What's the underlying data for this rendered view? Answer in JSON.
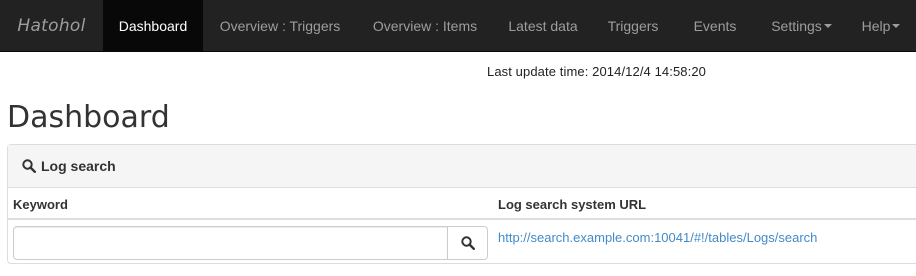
{
  "navbar": {
    "brand": "Hatohol",
    "items": [
      {
        "label": "Dashboard"
      },
      {
        "label": "Overview : Triggers"
      },
      {
        "label": "Overview : Items"
      },
      {
        "label": "Latest data"
      },
      {
        "label": "Triggers"
      },
      {
        "label": "Events"
      },
      {
        "label": "Settings"
      },
      {
        "label": "Help"
      }
    ]
  },
  "status": {
    "last_update": "Last update time: 2014/12/4 14:58:20"
  },
  "page": {
    "title": "Dashboard"
  },
  "log_search": {
    "heading": "Log search",
    "columns": {
      "keyword": "Keyword",
      "url": "Log search system URL"
    },
    "search_value": "",
    "url": "http://search.example.com:10041/#!/tables/Logs/search"
  },
  "colors": {
    "navbar_bg": "#222222",
    "active_bg": "#080808",
    "link": "#428bca"
  }
}
